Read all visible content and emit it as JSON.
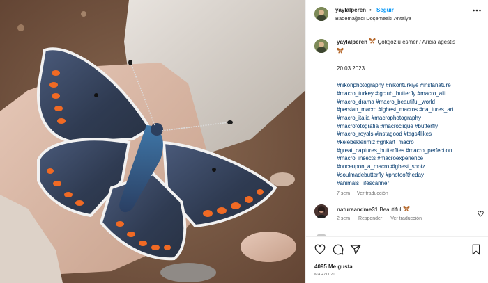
{
  "header": {
    "username": "yaylalperen",
    "separator": "•",
    "follow_label": "Seguir",
    "location": "Bademağacı Döşemealtı Antalya",
    "more_icon": "more-horizontal-icon"
  },
  "caption": {
    "username": "yaylalperen",
    "emoji_icon": "butterfly-emoji",
    "text": "Çokgözlü esmer / Aricia agestis",
    "date": "20.03.2023",
    "hashtag_lines": [
      "#nikonphotography #nikonturkiye #instanature",
      "#macro_turkey #igclub_butterfly #macro_alit",
      "#macro_drama #macro_beautiful_world",
      "#persian_macro #igbest_macros #na_tures_art",
      "#macro_italia #macrophotography",
      "#macrofotografia #macroclique #butterfly",
      "#macro_royals #instagood #tags4likes",
      "#kelebeklerimiz #grikart_macro",
      "#great_captures_butterflies #macro_perfection",
      "#macro_insects #macroexperience",
      "#onceupon_a_macro #igbest_shotz",
      "#soulmadebutterfly #photooftheday",
      "#animals_lifescanner"
    ],
    "age": "7 sem",
    "translation_label": "Ver traducción"
  },
  "comment": {
    "username": "natureandme31",
    "text": "Beautiful",
    "emoji_icon": "butterfly-emoji",
    "age": "2 sem",
    "reply_label": "Responder",
    "translation_label": "Ver traducción"
  },
  "actions": {
    "likes_text": "4095 Me gusta",
    "post_date": "MARZO 20",
    "icons": [
      "heart-icon",
      "comment-icon",
      "share-icon",
      "bookmark-icon"
    ]
  },
  "colors": {
    "follow_blue": "#0095f6",
    "hashtag_blue": "#00376b",
    "muted_gray": "#737373",
    "text": "#262626"
  }
}
